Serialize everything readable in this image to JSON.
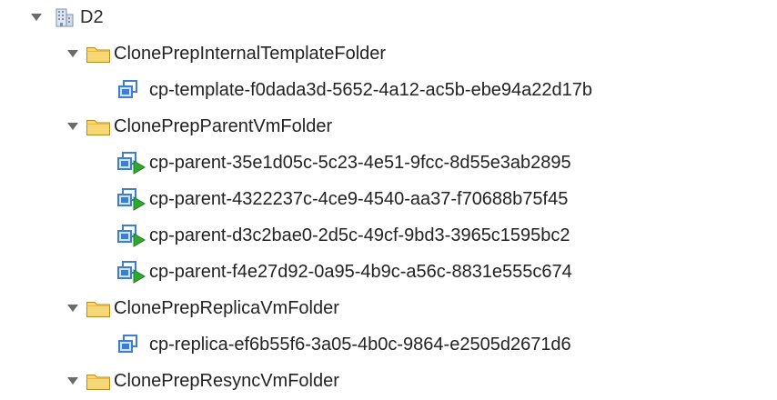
{
  "tree": {
    "root": {
      "label": "D2",
      "icon": "datacenter-icon",
      "expanded": true
    },
    "folders": [
      {
        "label": "ClonePrepInternalTemplateFolder",
        "icon": "folder-icon",
        "expanded": true,
        "children": [
          {
            "label": "cp-template-f0dada3d-5652-4a12-ac5b-ebe94a22d17b",
            "icon": "vm-template-icon"
          }
        ]
      },
      {
        "label": "ClonePrepParentVmFolder",
        "icon": "folder-icon",
        "expanded": true,
        "children": [
          {
            "label": "cp-parent-35e1d05c-5c23-4e51-9fcc-8d55e3ab2895",
            "icon": "vm-powered-on-icon"
          },
          {
            "label": "cp-parent-4322237c-4ce9-4540-aa37-f70688b75f45",
            "icon": "vm-powered-on-icon"
          },
          {
            "label": "cp-parent-d3c2bae0-2d5c-49cf-9bd3-3965c1595bc2",
            "icon": "vm-powered-on-icon"
          },
          {
            "label": "cp-parent-f4e27d92-0a95-4b9c-a56c-8831e555c674",
            "icon": "vm-powered-on-icon"
          }
        ]
      },
      {
        "label": "ClonePrepReplicaVmFolder",
        "icon": "folder-icon",
        "expanded": true,
        "children": [
          {
            "label": "cp-replica-ef6b55f6-3a05-4b0c-9864-e2505d2671d6",
            "icon": "vm-template-icon"
          }
        ]
      },
      {
        "label": "ClonePrepResyncVmFolder",
        "icon": "folder-icon",
        "expanded": true,
        "children": []
      }
    ]
  },
  "colors": {
    "folder_fill": "#f7d774",
    "folder_stroke": "#b98b1c",
    "vm_blue": "#3a7fd0",
    "power_green": "#2ea82e",
    "toggle_gray": "#6b6b6b"
  }
}
